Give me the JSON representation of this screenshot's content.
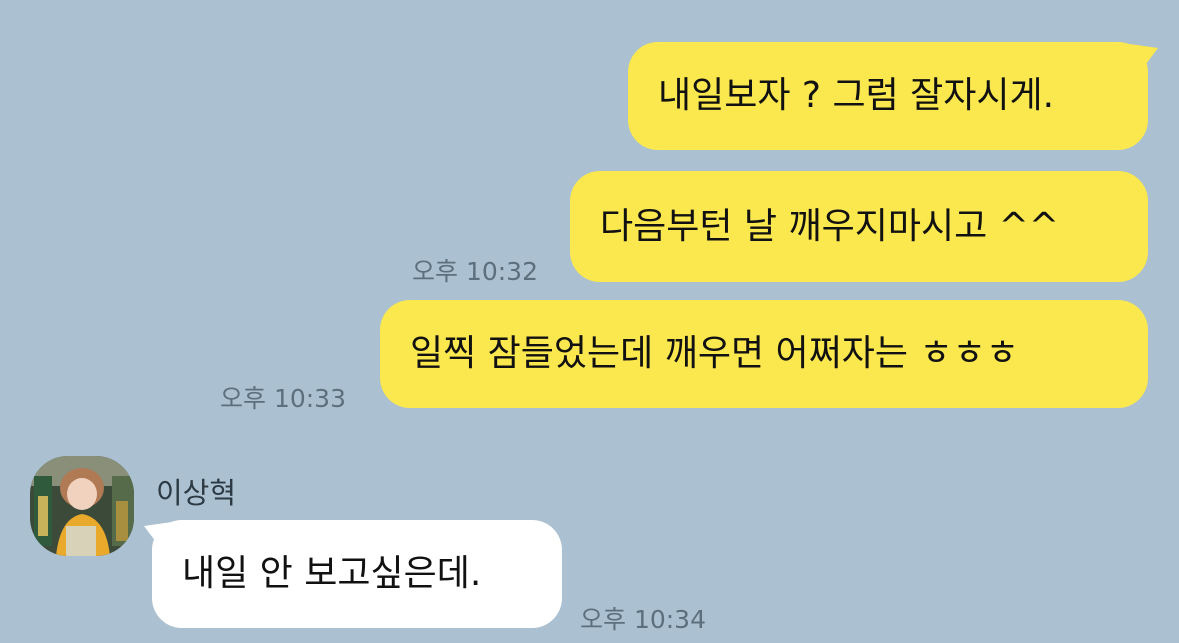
{
  "colors": {
    "background": "#abc1d1",
    "my_bubble": "#fbe74e",
    "their_bubble": "#ffffff",
    "timestamp": "#5d6f7d"
  },
  "messages": {
    "m1": {
      "text": "내일보자 ? 그럼 잘자시게."
    },
    "m2": {
      "text": "다음부턴 날 깨우지마시고 ^^",
      "time": "오후 10:32"
    },
    "m3": {
      "text": "일찍 잠들었는데 깨우면 어쩌자는 ㅎㅎㅎ",
      "time": "오후 10:33"
    },
    "m4": {
      "sender": "이상혁",
      "text": "내일 안 보고싶은데.",
      "time": "오후 10:34"
    }
  },
  "icons": {
    "avatar": "profile-photo-avatar"
  }
}
